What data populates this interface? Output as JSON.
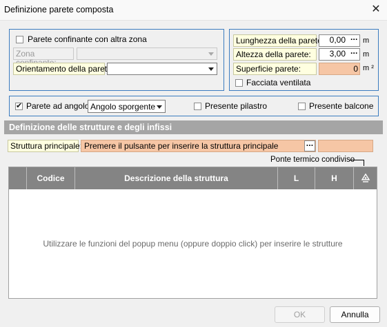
{
  "window": {
    "title": "Definizione parete composta"
  },
  "zone": {
    "adjacent_checkbox_label": "Parete confinante con altra zona",
    "adjacent_checked": false,
    "zone_label": "Zona confinante:",
    "zone_value": "",
    "orientation_label": "Orientamento della parete:",
    "orientation_value": ""
  },
  "dimensions": {
    "length_label": "Lunghezza della parete:",
    "length_value": "0,00",
    "length_unit": "m",
    "height_label": "Altezza della parete:",
    "height_value": "3,00",
    "height_unit": "m",
    "surface_label": "Superficie parete:",
    "surface_value": "0",
    "surface_unit": "m ²",
    "ventilated_label": "Facciata ventilata",
    "ventilated_checked": false
  },
  "options": {
    "corner_label": "Parete ad angolo",
    "corner_checked": true,
    "corner_type_value": "Angolo sporgente",
    "pillar_label": "Presente pilastro",
    "pillar_checked": false,
    "balcony_label": "Presente balcone",
    "balcony_checked": false
  },
  "structures": {
    "section_title": "Definizione delle strutture e degli infissi",
    "main_label": "Struttura principale:",
    "main_value": "Premere il pulsante per inserire la struttura principale",
    "thermal_bridge_label": "Ponte termico condiviso",
    "columns": [
      "",
      "Codice",
      "Descrizione della struttura",
      "L",
      "H",
      ""
    ],
    "empty_message": "Utilizzare le funzioni del popup menu (oppure doppio click) per inserire le strutture",
    "rows": []
  },
  "buttons": {
    "ok": "OK",
    "cancel": "Annulla"
  },
  "icons": {
    "close": "close-icon",
    "ellipsis": "ellipsis-icon",
    "dropdown": "chevron-down-icon",
    "thermal": "thermal-bridge-icon"
  },
  "colors": {
    "accent_border": "#3a7bbf",
    "peach_field": "#f6c6a5",
    "label_yellow": "#ffffe0",
    "section_header": "#a5a5a5",
    "table_header": "#848484"
  }
}
